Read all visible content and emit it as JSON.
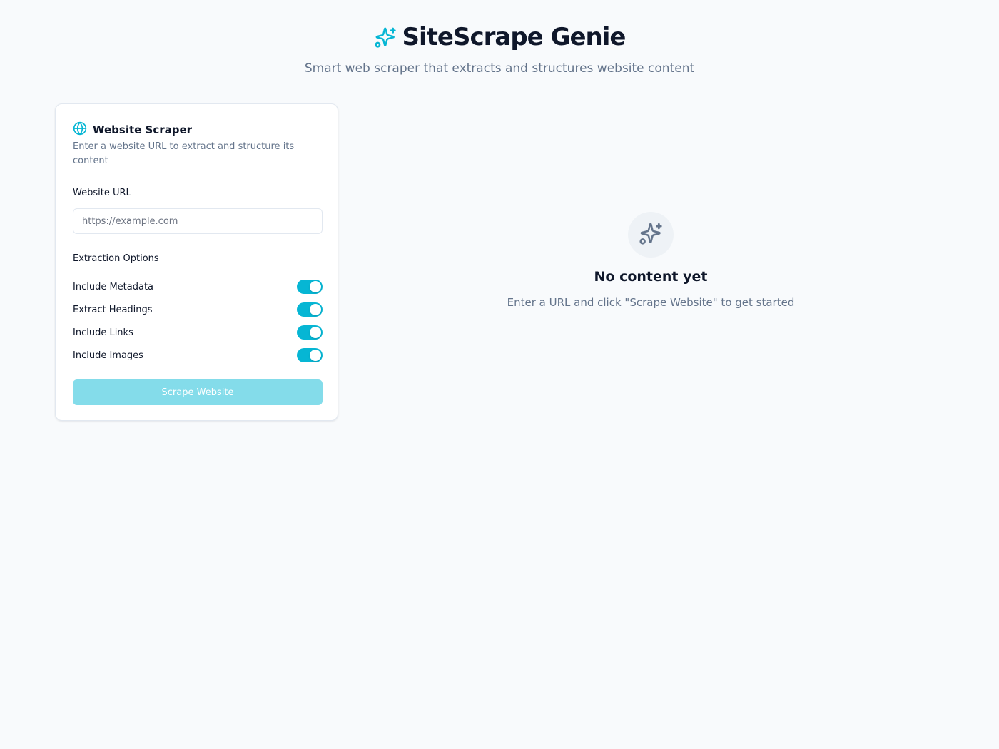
{
  "header": {
    "title": "SiteScrape Genie",
    "subtitle": "Smart web scraper that extracts and structures website content",
    "icon": "sparkles-icon"
  },
  "scraper_card": {
    "icon": "globe-icon",
    "title": "Website Scraper",
    "description": "Enter a website URL to extract and structure its content",
    "url_label": "Website URL",
    "url_value": "",
    "url_placeholder": "https://example.com",
    "options_label": "Extraction Options",
    "options": [
      {
        "label": "Include Metadata",
        "enabled": true
      },
      {
        "label": "Extract Headings",
        "enabled": true
      },
      {
        "label": "Include Links",
        "enabled": true
      },
      {
        "label": "Include Images",
        "enabled": true
      }
    ],
    "submit_label": "Scrape Website"
  },
  "empty_state": {
    "icon": "sparkles-icon",
    "title": "No content yet",
    "description": "Enter a URL and click \"Scrape Website\" to get started"
  },
  "colors": {
    "accent": "#06b6d4",
    "button_disabled": "#84dcea",
    "background": "#f8fafc",
    "text_primary": "#0f172a",
    "text_muted": "#64748b"
  }
}
